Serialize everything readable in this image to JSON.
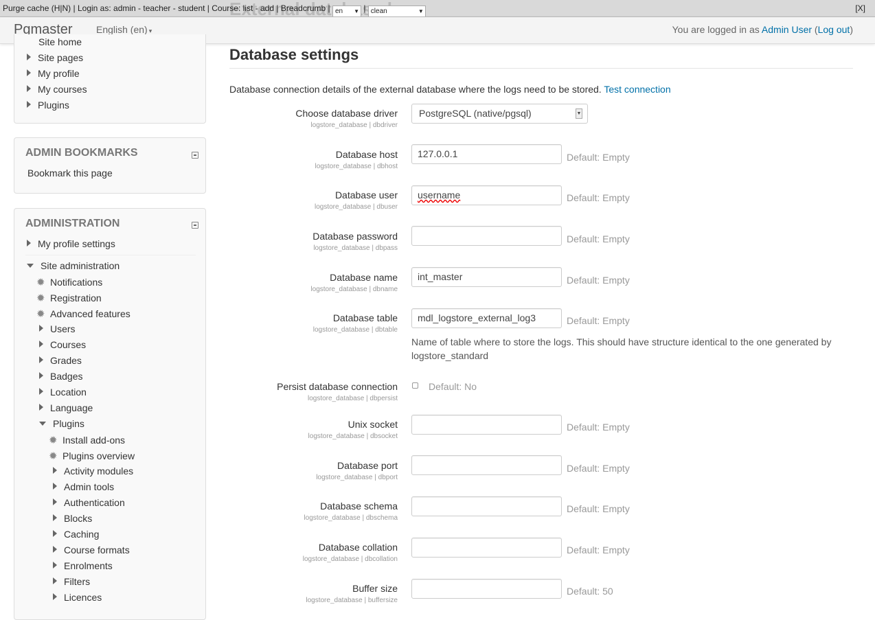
{
  "devbar": {
    "ghost": "External database log",
    "purge": "Purge cache",
    "purge_keys": "(H|N)",
    "login_as": "Login as:",
    "admin": "admin",
    "teacher": "teacher",
    "student": "student",
    "course": "Course:",
    "list": "list",
    "add": "add",
    "breadcrumb": "Breadcrumb",
    "lang_select": "en",
    "theme_select": "clean",
    "close": "[X]"
  },
  "navbar": {
    "brand": "Pgmaster",
    "language": "English (en)",
    "logged_prefix": "You are logged in as",
    "user": "Admin User",
    "logout": "Log out"
  },
  "nav_block": {
    "items": [
      "Site home",
      "Site pages",
      "My profile",
      "My courses",
      "Plugins"
    ]
  },
  "bookmarks_block": {
    "title": "ADMIN BOOKMARKS",
    "link": "Bookmark this page"
  },
  "admin_block": {
    "title": "ADMINISTRATION",
    "my_profile_settings": "My profile settings",
    "site_administration": "Site administration",
    "notifications": "Notifications",
    "registration": "Registration",
    "advanced_features": "Advanced features",
    "users": "Users",
    "courses": "Courses",
    "grades": "Grades",
    "badges": "Badges",
    "location": "Location",
    "language": "Language",
    "plugins": "Plugins",
    "install_addons": "Install add-ons",
    "plugins_overview": "Plugins overview",
    "activity_modules": "Activity modules",
    "admin_tools": "Admin tools",
    "authentication": "Authentication",
    "blocks": "Blocks",
    "caching": "Caching",
    "course_formats": "Course formats",
    "enrolments": "Enrolments",
    "filters": "Filters",
    "licences": "Licences"
  },
  "main": {
    "title": "Database settings",
    "intro": "Database connection details of the external database where the logs need to be stored.",
    "test_connection": "Test connection",
    "driver": {
      "label": "Choose database driver",
      "key": "logstore_database | dbdriver",
      "value": "PostgreSQL (native/pgsql)"
    },
    "host": {
      "label": "Database host",
      "key": "logstore_database | dbhost",
      "value": "127.0.0.1",
      "default": "Default: Empty"
    },
    "user": {
      "label": "Database user",
      "key": "logstore_database | dbuser",
      "value": "username",
      "default": "Default: Empty"
    },
    "password": {
      "label": "Database password",
      "key": "logstore_database | dbpass",
      "value": "",
      "default": "Default: Empty"
    },
    "name": {
      "label": "Database name",
      "key": "logstore_database | dbname",
      "value": "int_master",
      "default": "Default: Empty"
    },
    "table": {
      "label": "Database table",
      "key": "logstore_database | dbtable",
      "value": "mdl_logstore_external_log3",
      "default": "Default: Empty",
      "description": "Name of table where to store the logs. This should have structure identical to the one generated by logstore_standard"
    },
    "persist": {
      "label": "Persist database connection",
      "key": "logstore_database | dbpersist",
      "default": "Default: No"
    },
    "socket": {
      "label": "Unix socket",
      "key": "logstore_database | dbsocket",
      "value": "",
      "default": "Default: Empty"
    },
    "port": {
      "label": "Database port",
      "key": "logstore_database | dbport",
      "value": "",
      "default": "Default: Empty"
    },
    "schema": {
      "label": "Database schema",
      "key": "logstore_database | dbschema",
      "value": "",
      "default": "Default: Empty"
    },
    "collation": {
      "label": "Database collation",
      "key": "logstore_database | dbcollation",
      "value": "",
      "default": "Default: Empty"
    },
    "buffer": {
      "label": "Buffer size",
      "key": "logstore_database | buffersize",
      "value": "",
      "default": "Default: 50"
    }
  }
}
